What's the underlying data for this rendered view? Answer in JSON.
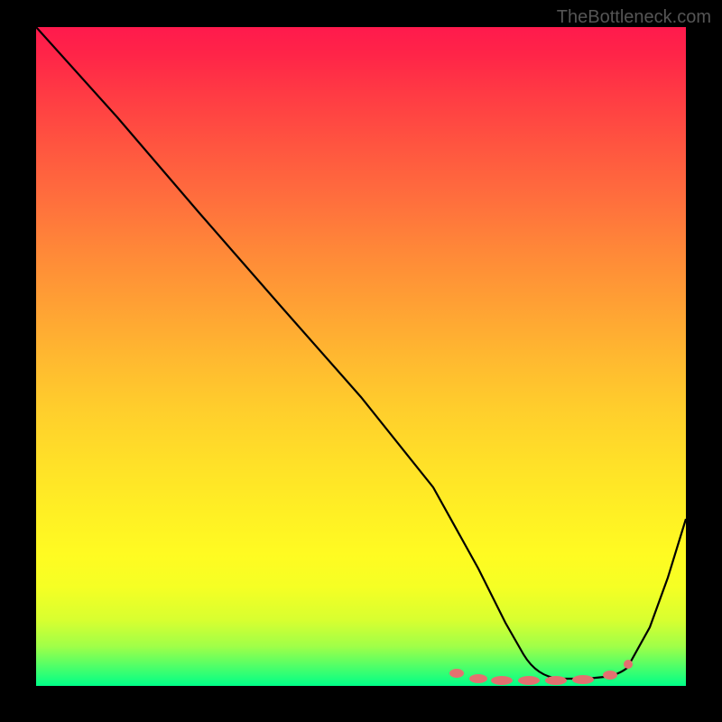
{
  "watermark": "TheBottleneck.com",
  "chart_data": {
    "type": "line",
    "title": "",
    "xlabel": "",
    "ylabel": "",
    "xlim": [
      0,
      100
    ],
    "ylim": [
      0,
      100
    ],
    "series": [
      {
        "name": "main-curve",
        "x": [
          0,
          10,
          20,
          30,
          40,
          50,
          60,
          68,
          72,
          75,
          80,
          85,
          88,
          92,
          96,
          100
        ],
        "y": [
          100,
          86,
          72,
          58,
          44,
          30,
          16,
          4,
          1.5,
          1,
          1,
          1,
          2,
          8,
          20,
          35
        ]
      },
      {
        "name": "marker-points",
        "x": [
          65,
          68,
          72,
          76,
          80,
          84,
          88
        ],
        "y": [
          1.5,
          1.5,
          1.5,
          1.5,
          1.5,
          1.5,
          2.5
        ]
      }
    ],
    "gradient_stops": [
      {
        "offset": 0,
        "color": "#ff1a4d"
      },
      {
        "offset": 50,
        "color": "#ffb830"
      },
      {
        "offset": 85,
        "color": "#fffb22"
      },
      {
        "offset": 100,
        "color": "#00ff88"
      }
    ]
  }
}
